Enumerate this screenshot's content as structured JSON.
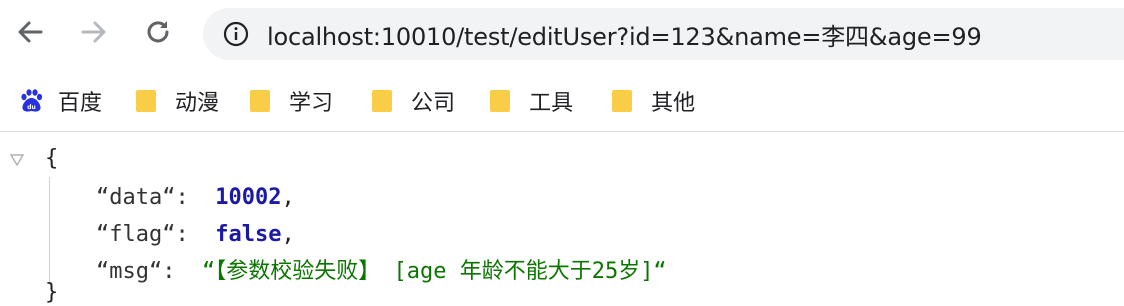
{
  "browser": {
    "url": "localhost:10010/test/editUser?id=123&name=李四&age=99",
    "nav": {
      "back_icon": "arrow-left-icon",
      "forward_icon": "arrow-right-icon",
      "reload_icon": "reload-icon",
      "info_icon": "info-icon"
    }
  },
  "bookmarks": [
    {
      "label": "百度",
      "icon": "baidu-paw-icon"
    },
    {
      "label": "动漫",
      "icon": "folder-icon"
    },
    {
      "label": "学习",
      "icon": "folder-icon"
    },
    {
      "label": "公司",
      "icon": "folder-icon"
    },
    {
      "label": "工具",
      "icon": "folder-icon"
    },
    {
      "label": "其他",
      "icon": "folder-icon"
    }
  ],
  "json_viewer": {
    "open_brace": "{",
    "close_brace": "}",
    "entries": [
      {
        "key": "“data“:",
        "value": "10002",
        "type": "number"
      },
      {
        "key": "“flag“:",
        "value": "false",
        "type": "boolean"
      },
      {
        "key": "“msg“:",
        "value": "“【参数校验失败】 [age 年龄不能大于25岁]“",
        "type": "string"
      }
    ]
  },
  "colors": {
    "folder": "#f9cd45",
    "baidu": "#2932e1",
    "json_number": "#1a1aa6",
    "json_string": "#0b7500",
    "omnibox_bg": "#f1f3f4"
  }
}
